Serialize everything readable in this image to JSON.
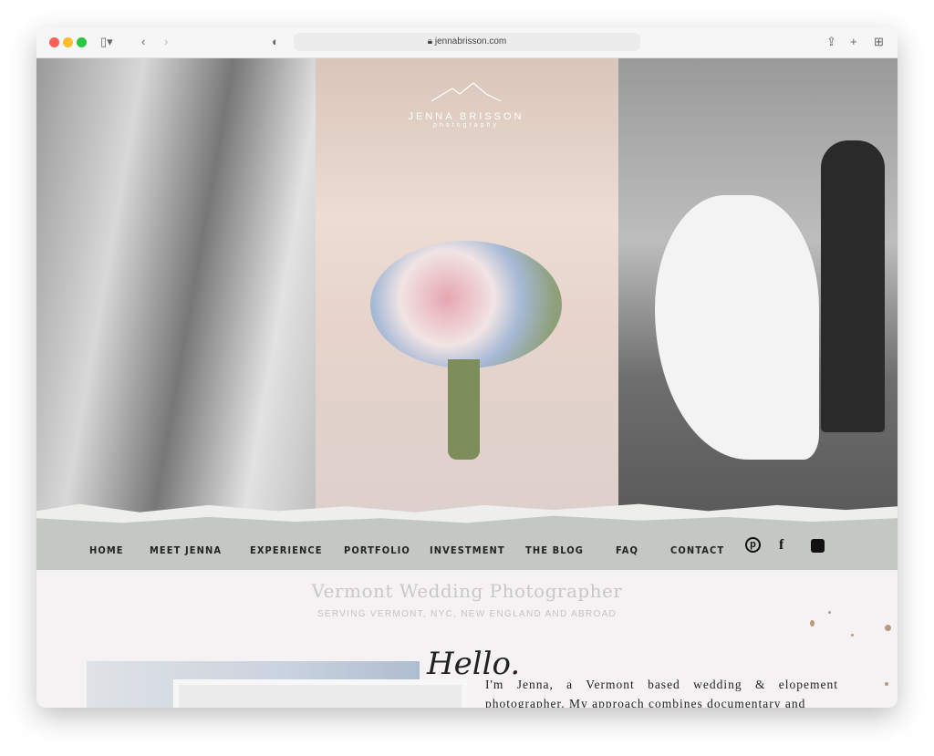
{
  "browser": {
    "url": "jennabrisson.com"
  },
  "logo": {
    "name": "JENNA BRISSON",
    "sub": "photography"
  },
  "nav": {
    "items": [
      "HOME",
      "MEET JENNA",
      "EXPERIENCE",
      "PORTFOLIO",
      "INVESTMENT",
      "THE BLOG",
      "FAQ",
      "CONTACT"
    ],
    "social": [
      "pinterest-icon",
      "facebook-icon",
      "instagram-icon"
    ]
  },
  "hero": {
    "title": "Vermont Wedding Photographer",
    "subtitle": "SERVING VERMONT, NYC, NEW ENGLAND AND ABROAD"
  },
  "intro": {
    "script": "Hello.",
    "text": "I'm Jenna, a Vermont based wedding & elopement photographer. My approach combines documentary and"
  },
  "colors": {
    "nav_bg": "#c4c8c2",
    "page_bg": "#f4f2f2"
  }
}
